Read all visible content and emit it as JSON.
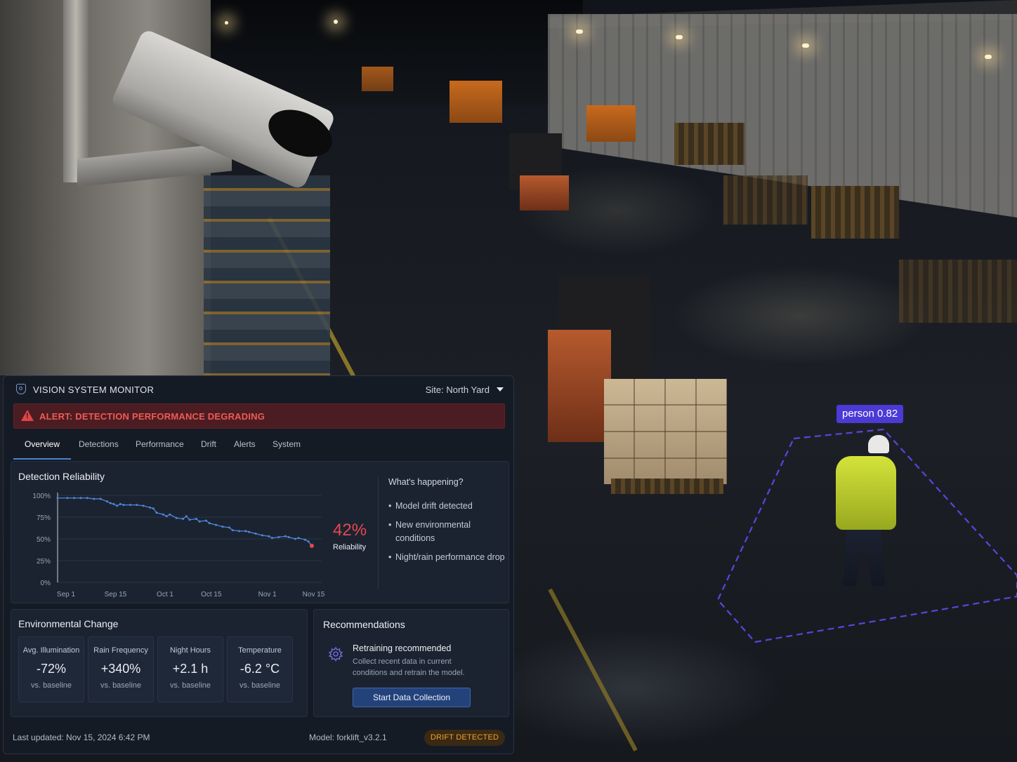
{
  "scene": {
    "detection": {
      "label": "person 0.82",
      "box_color": "#5b45e0"
    }
  },
  "header": {
    "title": "VISION SYSTEM MONITOR",
    "site_label": "Site: North Yard"
  },
  "alert": {
    "text": "ALERT: DETECTION PERFORMANCE DEGRADING",
    "color": "#ee5a55"
  },
  "tabs": [
    {
      "label": "Overview",
      "active": true
    },
    {
      "label": "Detections"
    },
    {
      "label": "Performance"
    },
    {
      "label": "Drift"
    },
    {
      "label": "Alerts"
    },
    {
      "label": "System"
    }
  ],
  "reliability": {
    "title": "Detection Reliability",
    "current_value": "42%",
    "current_label": "Reliability",
    "whats_happening_title": "What's happening?",
    "bullets": [
      "Model drift detected",
      "New environmental conditions",
      "Night/rain performance drop"
    ]
  },
  "chart_data": {
    "type": "line",
    "title": "Detection Reliability",
    "xlabel": "",
    "ylabel": "",
    "y_ticks": [
      "100%",
      "75%",
      "50%",
      "25%",
      "0%"
    ],
    "x_ticks": [
      "Sep 1",
      "Sep 15",
      "Oct 1",
      "Oct 15",
      "Nov 1",
      "Nov 15"
    ],
    "ylim": [
      0,
      100
    ],
    "grid": true,
    "series": [
      {
        "color": "#4f86d8",
        "x": [
          0,
          3,
          5,
          7,
          9,
          11,
          13,
          15,
          16,
          17,
          18,
          19,
          20,
          22,
          24,
          26,
          28,
          29,
          30,
          32,
          33,
          34,
          36,
          38,
          39,
          40,
          42,
          43,
          45,
          46,
          48,
          50,
          52,
          53,
          55,
          57,
          58,
          60,
          62,
          64,
          65,
          67,
          69,
          70,
          72,
          73,
          75,
          76
        ],
        "y": [
          97,
          97,
          97,
          97,
          97,
          96,
          96,
          93,
          91,
          90,
          88,
          90,
          89,
          89,
          89,
          88,
          86,
          85,
          80,
          78,
          76,
          78,
          74,
          73,
          76,
          72,
          73,
          70,
          71,
          68,
          66,
          64,
          63,
          60,
          59,
          59,
          58,
          56,
          54,
          53,
          51,
          52,
          53,
          52,
          50,
          51,
          49,
          47
        ]
      }
    ],
    "last_point": {
      "x": 77,
      "y": 42,
      "color": "#e5484d"
    }
  },
  "environment": {
    "title": "Environmental Change",
    "items": [
      {
        "label": "Avg. Illumination",
        "value": "-72%",
        "sub": "vs. baseline"
      },
      {
        "label": "Rain Frequency",
        "value": "+340%",
        "sub": "vs. baseline"
      },
      {
        "label": "Night Hours",
        "value": "+2.1 h",
        "sub": "vs. baseline"
      },
      {
        "label": "Temperature",
        "value": "-6.2 °C",
        "sub": "vs. baseline"
      }
    ]
  },
  "recommendations": {
    "title": "Recommendations",
    "item_title": "Retraining recommended",
    "item_desc": "Collect recent data in current conditions and retrain the model.",
    "button_label": "Start Data Collection"
  },
  "footer": {
    "last_updated": "Last updated: Nov 15, 2024 6:42 PM",
    "model": "Model: forklift_v3.2.1",
    "status_badge": "DRIFT DETECTED"
  }
}
